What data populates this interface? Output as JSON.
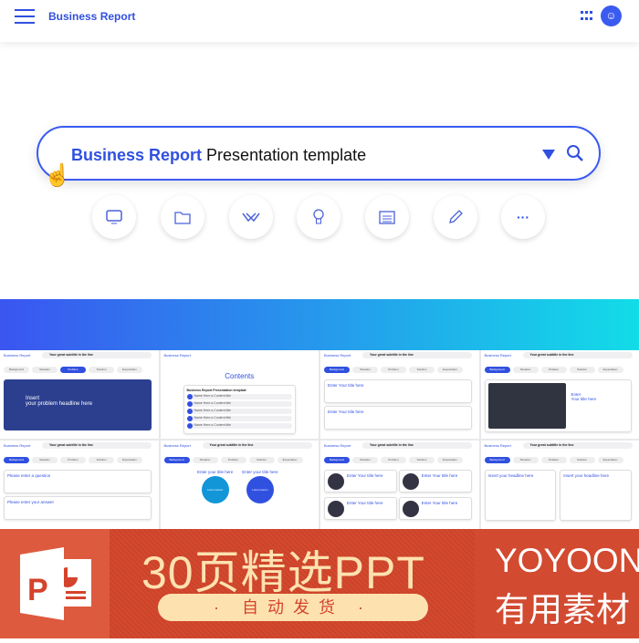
{
  "header": {
    "title": "Business Report",
    "avatar_icon": "user-icon",
    "menu_icon": "hamburger-icon",
    "apps_icon": "grid-icon"
  },
  "search": {
    "highlight": "Business Report",
    "rest": " Presentation template",
    "dropdown_icon": "triangle-down-icon",
    "search_icon": "search-icon"
  },
  "categories": [
    "monitor-icon",
    "folder-icon",
    "handshake-icon",
    "lightbulb-icon",
    "calendar-icon",
    "pencil-icon",
    "more-icon"
  ],
  "colors": {
    "accent": "#3050e0",
    "gradient_start": "#3a55f0",
    "gradient_end": "#12dce8",
    "banner": "#d4432c",
    "banner_text": "#fde2b0"
  },
  "thumb_common": {
    "brand": "Business Report",
    "subtitle": "Your great subtitle in the line",
    "tabs": [
      "Background",
      "Situation",
      "Problem",
      "Solution",
      "Expectation"
    ]
  },
  "thumbs": [
    {
      "active": 2,
      "titles": [
        "Insert",
        "your problem headline here"
      ]
    },
    {
      "active": -1,
      "titles": [
        "Contents",
        "Business Report Presentation template",
        "Name Here a Content title",
        "Name Here a Content title",
        "Name Here a Content title",
        "Name Here a Content title",
        "Name Here a Content title"
      ]
    },
    {
      "active": 0,
      "titles": [
        "Enter Your title here",
        "Enter Your title here"
      ]
    },
    {
      "active": 0,
      "titles": [
        "Enter",
        "Your title here"
      ]
    },
    {
      "active": 0,
      "titles": [
        "Please enter a question",
        "Please enter your answer"
      ]
    },
    {
      "active": 0,
      "titles": [
        "Enter your title here",
        "Enter your title here",
        "Lorem ipsum",
        "Lorem ipsum"
      ]
    },
    {
      "active": 0,
      "titles": [
        "Enter Your title here",
        "Enter Your title here",
        "Enter Your title here",
        "Enter Your title here"
      ]
    },
    {
      "active": 0,
      "titles": [
        "Insert your headline here",
        "Insert your headline here"
      ]
    }
  ],
  "banner": {
    "headline": "30页精选PPT",
    "pill": "· 自动发货 ·",
    "brand": "YOYOON",
    "brand_sub": "有用素材",
    "logo_letter": "P"
  }
}
